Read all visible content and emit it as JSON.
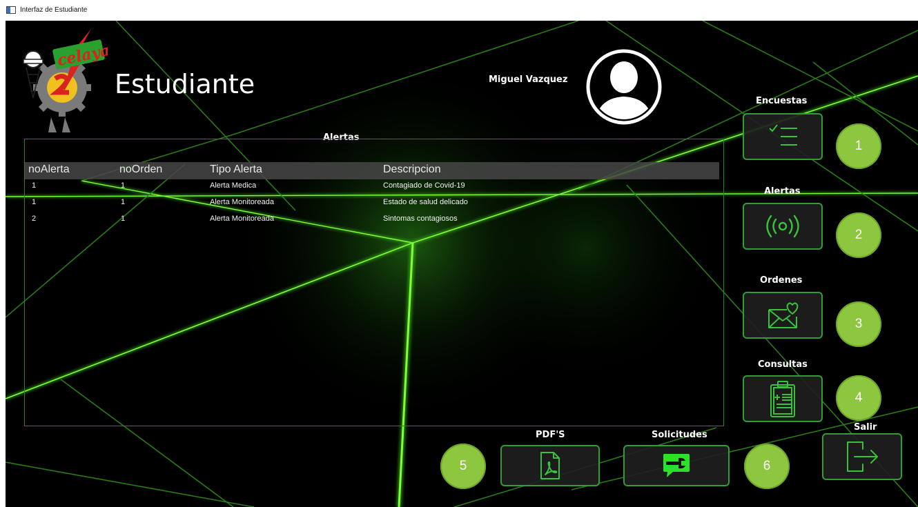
{
  "window": {
    "title": "Interfaz de Estudiante"
  },
  "header": {
    "role_title": "Estudiante",
    "user_name": "Miguel Vazquez"
  },
  "alerts": {
    "title": "Alertas",
    "columns": [
      "noAlerta",
      "noOrden",
      "Tipo Alerta",
      "Descripcion"
    ],
    "rows": [
      [
        "1",
        "1",
        "Alerta Medica",
        "Contagiado de Covid-19"
      ],
      [
        "1",
        "1",
        "Alerta Monitoreada",
        "Estado de salud delicado"
      ],
      [
        "2",
        "1",
        "Alerta Monitoreada",
        "Sintomas contagiosos"
      ]
    ]
  },
  "nav": {
    "encuestas": {
      "label": "Encuestas",
      "icon": "checklist-icon",
      "badge": "1"
    },
    "alertas": {
      "label": "Alertas",
      "icon": "broadcast-icon",
      "badge": "2"
    },
    "ordenes": {
      "label": "Ordenes",
      "icon": "mail-heart-icon",
      "badge": "3"
    },
    "consultas": {
      "label": "Consultas",
      "icon": "clipboard-icon",
      "badge": "4"
    },
    "pdfs": {
      "label": "PDF'S",
      "icon": "pdf-file-icon",
      "badge": "5"
    },
    "solicitudes": {
      "label": "Solicitudes",
      "icon": "chat-wrench-icon",
      "badge": "6"
    },
    "salir": {
      "label": "Salir",
      "icon": "exit-icon"
    }
  },
  "colors": {
    "accent": "#2f9e34",
    "badge": "#8dc63f",
    "neon": "#6cff2a"
  }
}
